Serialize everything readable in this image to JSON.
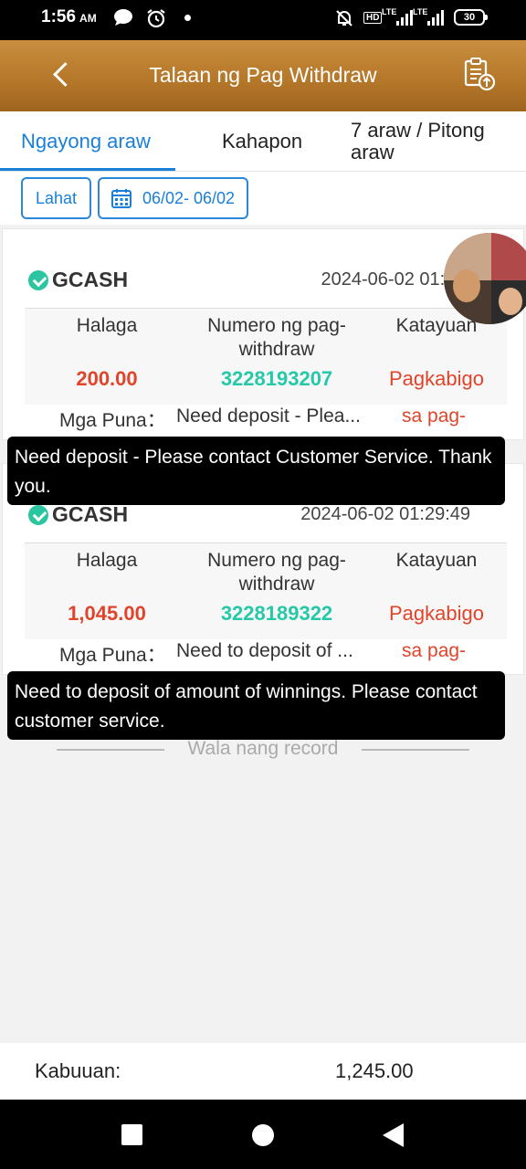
{
  "status_bar": {
    "time": "1:56",
    "ampm": "AM",
    "net1": "HD",
    "net2": "LTE",
    "net3": "LTE",
    "battery": "30",
    "icons": [
      "chat-icon",
      "alarm-icon",
      "notifications-off-icon",
      "signal-icon"
    ]
  },
  "header": {
    "title": "Talaan ng Pag Withdraw",
    "back_icon": "chevron-left-icon",
    "report_icon": "clipboard-upload-icon"
  },
  "tabs": [
    {
      "label": "Ngayong araw",
      "active": true
    },
    {
      "label": "Kahapon",
      "active": false
    },
    {
      "label": "7 araw / Pitong araw",
      "active": false
    }
  ],
  "filters": {
    "all_label": "Lahat",
    "date_range": "06/02- 06/02"
  },
  "records": [
    {
      "method": "GCASH",
      "datetime": "2024-06-02 01:46:",
      "col_amount": "Halaga",
      "col_number": "Numero ng pag-withdraw",
      "col_status": "Katayuan",
      "amount": "200.00",
      "withdraw_number": "3228193207",
      "status": "Pagkabigo",
      "remarks_label": "Mga Puna：",
      "remarks_preview": "Need deposit - Plea...",
      "status_note": "sa pag-",
      "tooltip": "Need deposit - Please contact Customer Service. Thank you."
    },
    {
      "method": "GCASH",
      "datetime": "2024-06-02 01:29:49",
      "col_amount": "Halaga",
      "col_number": "Numero ng pag-withdraw",
      "col_status": "Katayuan",
      "amount": "1,045.00",
      "withdraw_number": "3228189322",
      "status": "Pagkabigo",
      "remarks_label": "Mga Puna：",
      "remarks_preview": "Need to deposit of ...",
      "status_note": "sa pag-",
      "tooltip": "Need to deposit of amount of winnings. Please contact customer service."
    }
  ],
  "no_record": "Wala nang record",
  "total": {
    "label": "Kabuuan:",
    "value": "1,245.00"
  },
  "colors": {
    "header_gold": "#b47628",
    "accent_blue": "#1a7fd8",
    "amount_red": "#e0442a",
    "number_teal": "#25c9a8"
  }
}
